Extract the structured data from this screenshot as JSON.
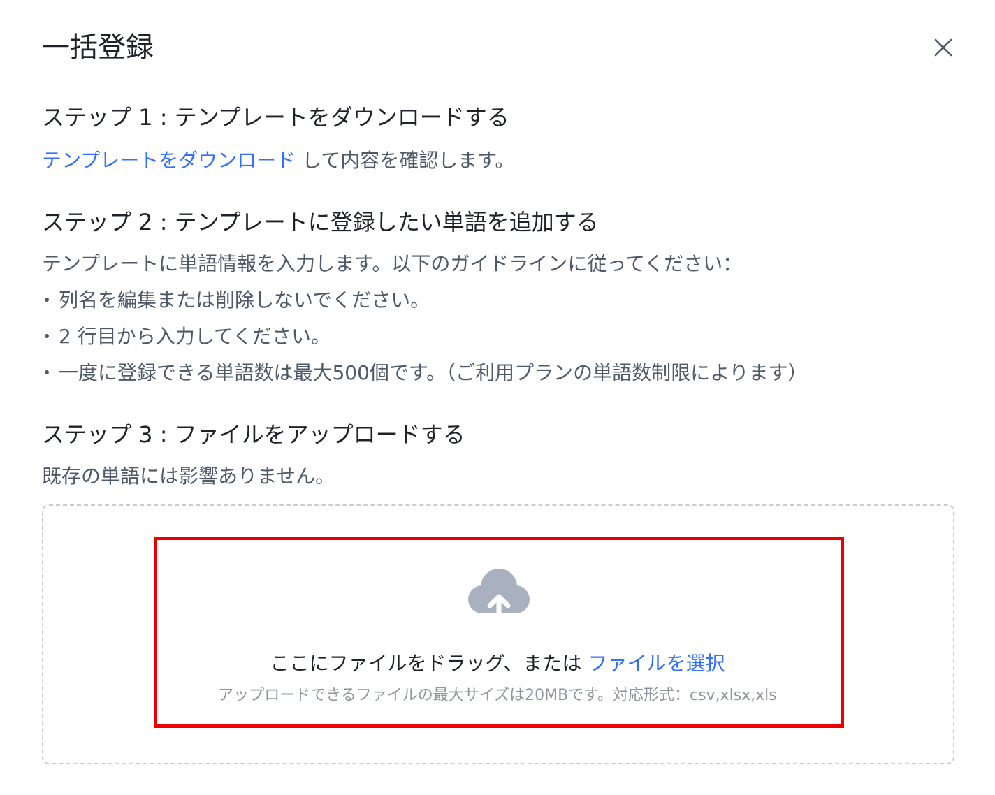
{
  "dialog": {
    "title": "一括登録",
    "close_icon": "close-icon"
  },
  "step1": {
    "title": "ステップ 1 : テンプレートをダウンロードする",
    "link": "テンプレートをダウンロード",
    "text": " して内容を確認します。"
  },
  "step2": {
    "title": "ステップ 2 : テンプレートに登録したい単語を追加する",
    "intro": "テンプレートに単語情報を入力します。以下のガイドラインに従ってください：",
    "bullets": [
      "列名を編集または削除しないでください。",
      "2 行目から入力してください。",
      "一度に登録できる単語数は最大500個です。（ご利用プランの単語数制限によります）"
    ]
  },
  "step3": {
    "title": "ステップ 3 : ファイルをアップロードする",
    "text": "既存の単語には影響ありません。"
  },
  "upload": {
    "icon": "cloud-upload-icon",
    "prompt": "ここにファイルをドラッグ、または ",
    "select_link": "ファイルを選択",
    "hint": "アップロードできるファイルの最大サイズは20MBです。対応形式：csv,xlsx,xls"
  },
  "colors": {
    "link": "#3370ff",
    "highlight": "#ee0000",
    "icon": "#a9b0bf"
  }
}
